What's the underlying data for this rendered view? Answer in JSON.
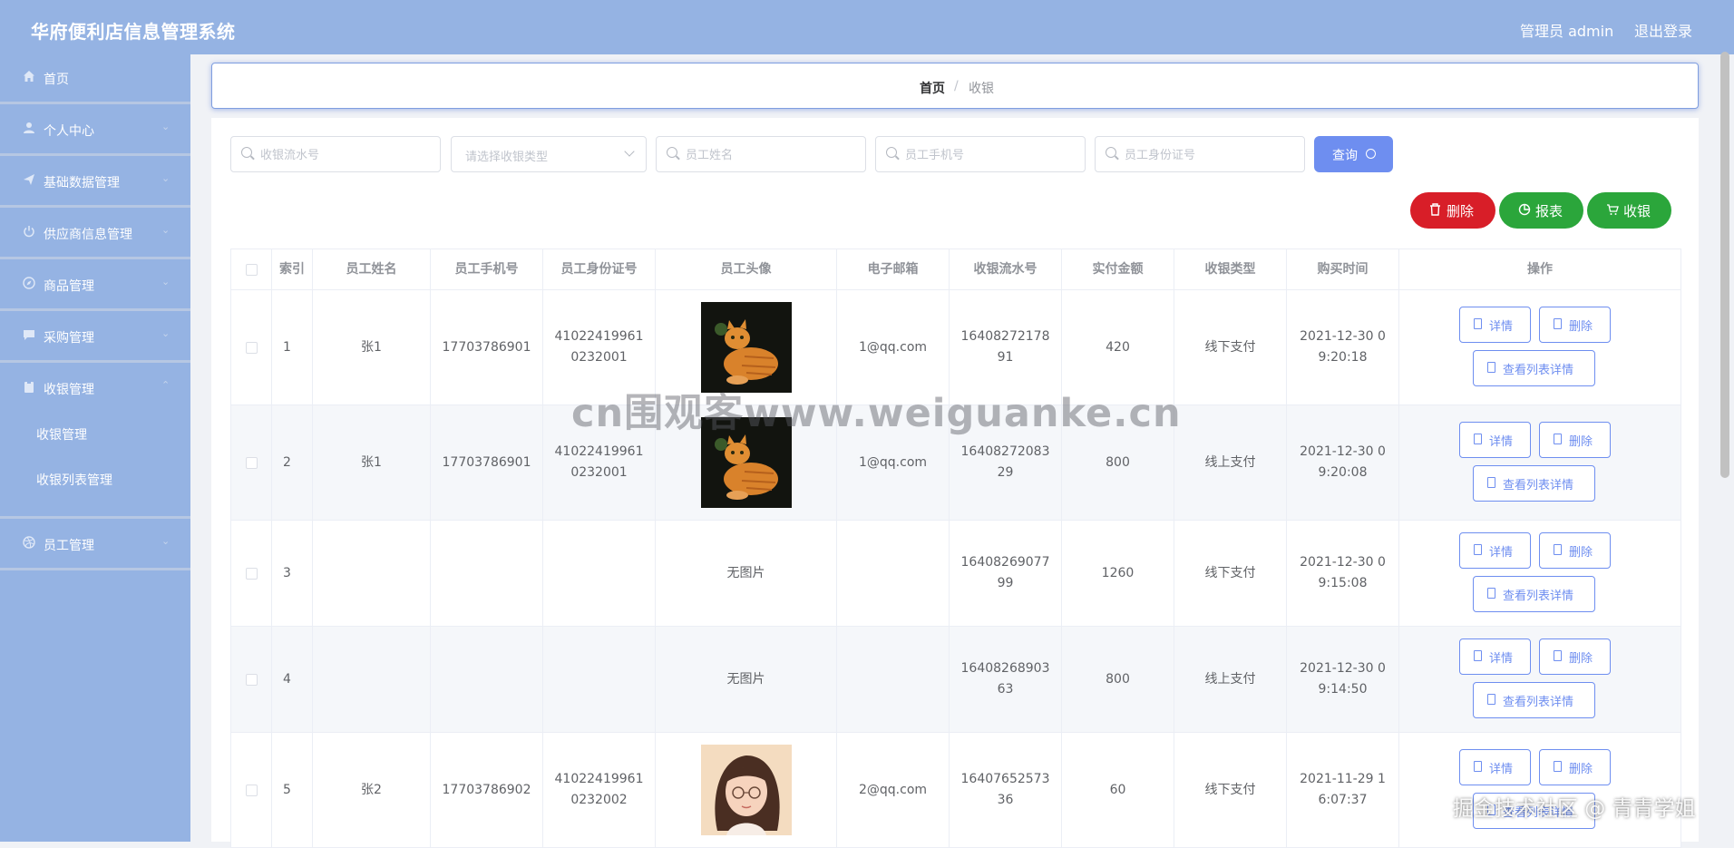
{
  "header": {
    "title": "华府便利店信息管理系统",
    "user": "管理员 admin",
    "logout": "退出登录"
  },
  "sidebar": {
    "items": [
      {
        "label": "首页",
        "icon": "home-icon"
      },
      {
        "label": "个人中心",
        "icon": "user-icon"
      },
      {
        "label": "基础数据管理",
        "icon": "paper-plane-icon"
      },
      {
        "label": "供应商信息管理",
        "icon": "power-icon"
      },
      {
        "label": "商品管理",
        "icon": "compass-icon"
      },
      {
        "label": "采购管理",
        "icon": "chat-icon"
      },
      {
        "label": "收银管理",
        "icon": "clipboard-icon"
      },
      {
        "label": "员工管理",
        "icon": "dribbble-icon"
      }
    ],
    "submenu": [
      "收银管理",
      "收银列表管理"
    ]
  },
  "breadcrumb": {
    "home": "首页",
    "separator": "/",
    "current": "收银"
  },
  "search": {
    "serial_placeholder": "收银流水号",
    "type_placeholder": "请选择收银类型",
    "name_placeholder": "员工姓名",
    "phone_placeholder": "员工手机号",
    "idcard_placeholder": "员工身份证号",
    "query_label": "查询"
  },
  "actions": {
    "delete": "删除",
    "report": "报表",
    "checkout": "收银"
  },
  "colors": {
    "topbar": "#95b3e3",
    "primary": "#6e8ef0",
    "danger": "#d81e28",
    "success": "#2ba63b"
  },
  "table": {
    "headers": [
      "索引",
      "员工姓名",
      "员工手机号",
      "员工身份证号",
      "员工头像",
      "电子邮箱",
      "收银流水号",
      "实付金额",
      "收银类型",
      "购买时间",
      "操作"
    ],
    "row_buttons": {
      "detail": "详情",
      "delete": "删除",
      "list_detail": "查看列表详情"
    },
    "rows": [
      {
        "index": "1",
        "name": "张1",
        "phone": "17703786901",
        "idcard": "410224199610232001",
        "avatar": "cat",
        "avatar_text": "",
        "email": "1@qq.com",
        "serial": "1640827217891",
        "amount": "420",
        "type": "线下支付",
        "time": "2021-12-30 09:20:18"
      },
      {
        "index": "2",
        "name": "张1",
        "phone": "17703786901",
        "idcard": "410224199610232001",
        "avatar": "cat",
        "avatar_text": "",
        "email": "1@qq.com",
        "serial": "1640827208329",
        "amount": "800",
        "type": "线上支付",
        "time": "2021-12-30 09:20:08"
      },
      {
        "index": "3",
        "name": "",
        "phone": "",
        "idcard": "",
        "avatar": "none",
        "avatar_text": "无图片",
        "email": "",
        "serial": "1640826907799",
        "amount": "1260",
        "type": "线下支付",
        "time": "2021-12-30 09:15:08"
      },
      {
        "index": "4",
        "name": "",
        "phone": "",
        "idcard": "",
        "avatar": "none",
        "avatar_text": "无图片",
        "email": "",
        "serial": "1640826890363",
        "amount": "800",
        "type": "线上支付",
        "time": "2021-12-30 09:14:50"
      },
      {
        "index": "5",
        "name": "张2",
        "phone": "17703786902",
        "idcard": "410224199610232002",
        "avatar": "girl",
        "avatar_text": "",
        "email": "2@qq.com",
        "serial": "1640765257336",
        "amount": "60",
        "type": "线下支付",
        "time": "2021-11-29 16:07:37"
      }
    ]
  },
  "watermarks": {
    "center": "cn围观客www.weiguanke.cn",
    "corner": "掘金技术社区 @ 青青学姐"
  }
}
